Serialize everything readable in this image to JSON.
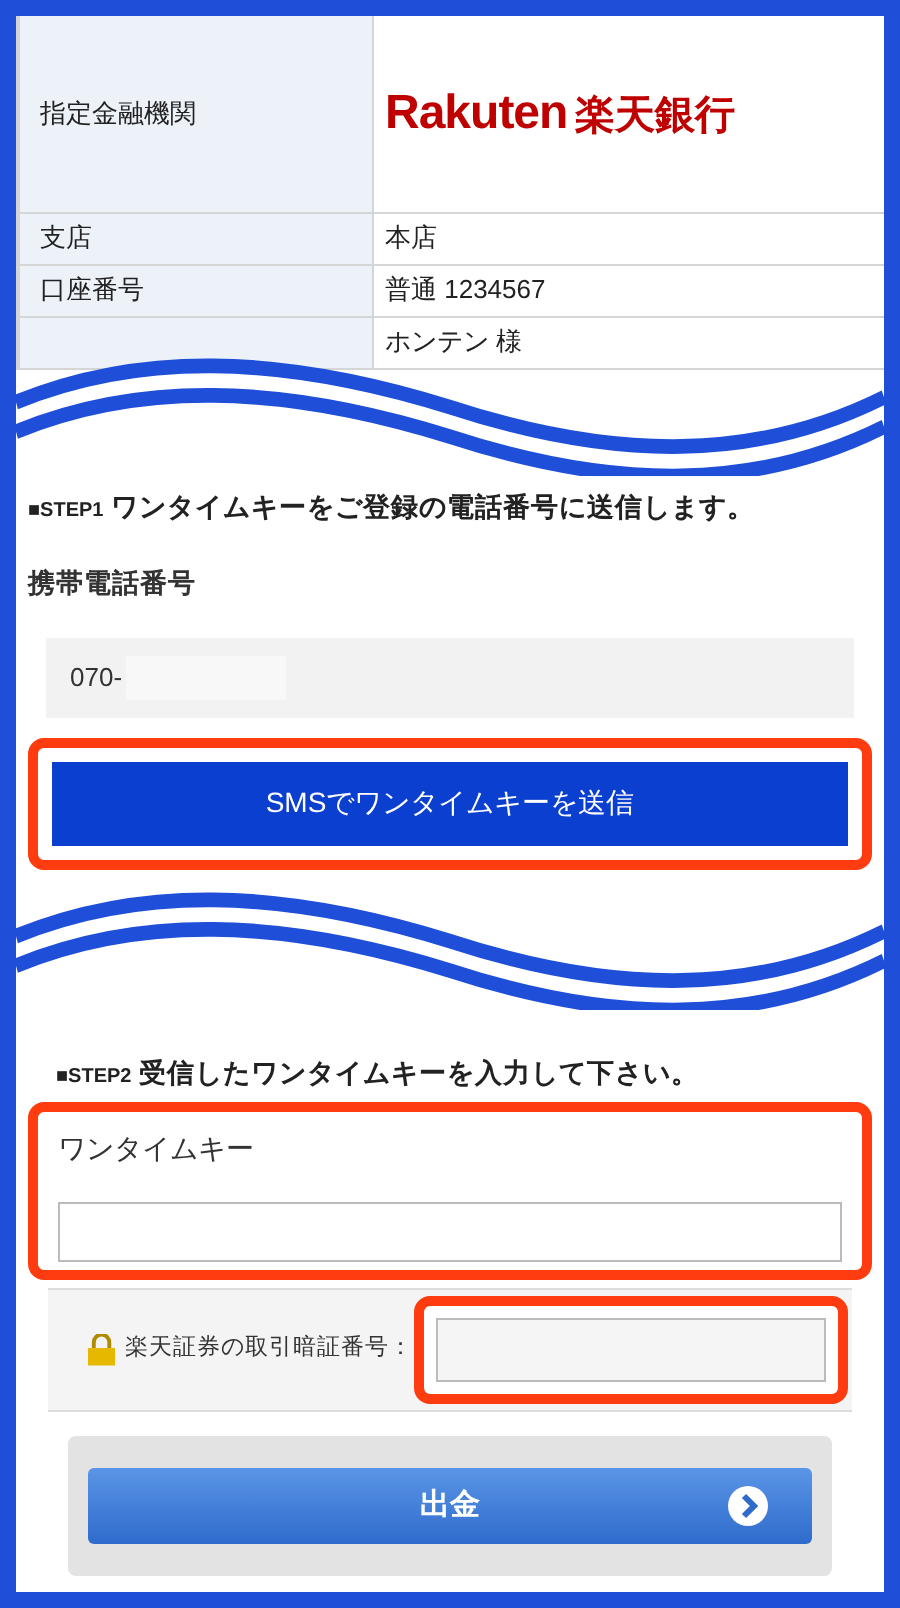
{
  "account_table": {
    "rows": [
      {
        "label": "指定金融機関",
        "logo": {
          "latin": "Rakuten",
          "kanji": "楽天銀行"
        }
      },
      {
        "label": "支店",
        "value": "本店"
      },
      {
        "label": "口座番号",
        "value": "普通 1234567"
      },
      {
        "value": "ホンテン 様"
      }
    ]
  },
  "step1": {
    "heading_mark": "■STEP1",
    "heading": "ワンタイムキーをご登録の電話番号に送信します。",
    "phone_label": "携帯電話番号",
    "phone_value": "070-",
    "send_button": "SMSでワンタイムキーを送信"
  },
  "step2": {
    "heading_mark": "■STEP2",
    "heading": "受信したワンタイムキーを入力して下さい。",
    "key_label": "ワンタイムキー",
    "pin_label": "楽天証券の取引暗証番号：",
    "submit_button": "出金"
  }
}
